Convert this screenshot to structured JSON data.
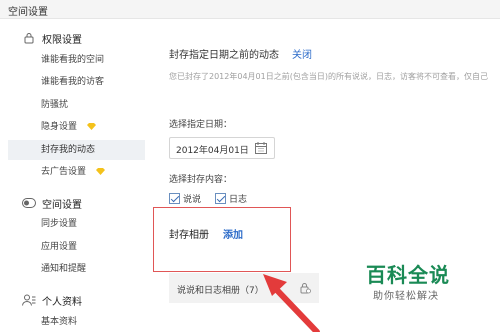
{
  "header": {
    "title": "空间设置"
  },
  "sidebar": {
    "sections": [
      {
        "title": "权限设置",
        "icon": "lock-icon"
      },
      {
        "title": "空间设置",
        "icon": "toggle-icon"
      },
      {
        "title": "个人资料",
        "icon": "user-icon"
      }
    ],
    "items": [
      {
        "label": "谁能看我的空间"
      },
      {
        "label": "谁能看我的访客"
      },
      {
        "label": "防骚扰"
      },
      {
        "label": "隐身设置",
        "badge": "gem-icon"
      },
      {
        "label": "封存我的动态",
        "active": true
      },
      {
        "label": "去广告设置",
        "badge": "gem-icon"
      },
      {
        "label": "同步设置"
      },
      {
        "label": "应用设置"
      },
      {
        "label": "通知和提醒"
      },
      {
        "label": "基本资料"
      }
    ]
  },
  "main": {
    "heading": "封存指定日期之前的动态",
    "close_link": "关闭",
    "description": "您已封存了2012年04月01日之前(包含当日)的所有说说，日志，访客将不可查看，仅自己",
    "date_label": "选择指定日期：",
    "date_value": "2012年04月01日",
    "content_label": "选择封存内容：",
    "options": [
      {
        "label": "说说",
        "checked": true
      },
      {
        "label": "日志",
        "checked": true
      }
    ],
    "album_label": "封存相册",
    "add_link": "添加",
    "album_row": "说说和日志相册（7）"
  },
  "watermark": {
    "title": "百科全说",
    "subtitle": "助你轻松解决"
  },
  "colors": {
    "link": "#2d6cc9",
    "highlight": "#e05656",
    "watermark": "#1a8a55",
    "active_bg": "#eef1f4"
  }
}
